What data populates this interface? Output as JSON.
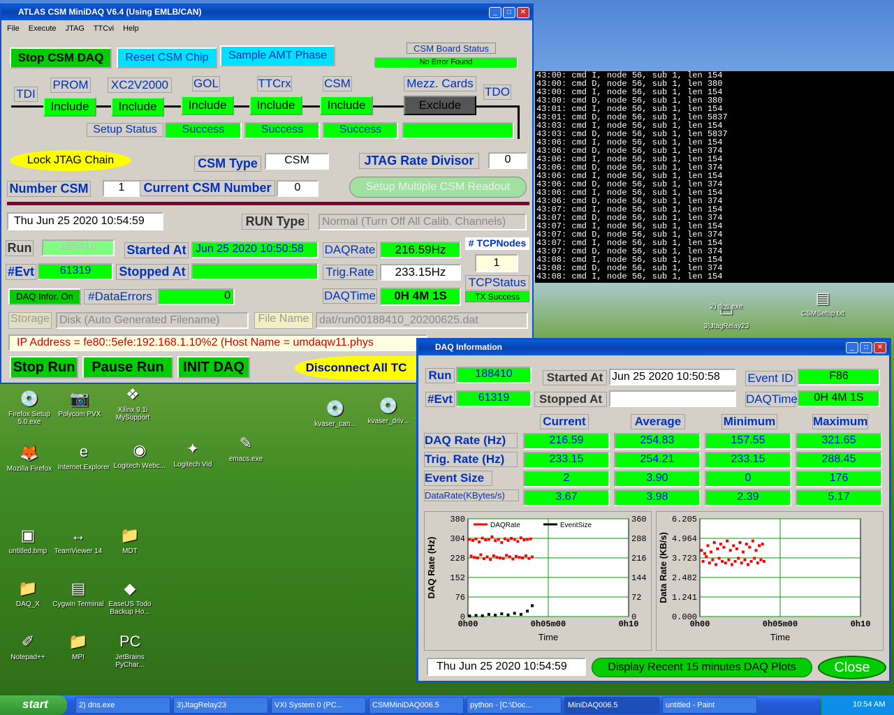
{
  "main": {
    "title": "ATLAS CSM MiniDAQ V6.4 (Using EMLB/CAN)",
    "menu": [
      "File",
      "Execute",
      "JTAG",
      "TTCvi",
      "Help"
    ],
    "stop_csm": "Stop CSM DAQ",
    "reset_csm": "Reset CSM Chip",
    "sample_amt": "Sample AMT Phase",
    "board_status_lbl": "CSM Board Status",
    "board_status": "No Error Found",
    "tdi": "TDI",
    "tdo": "TDO",
    "chain": [
      {
        "name": "PROM",
        "state": "Include"
      },
      {
        "name": "XC2V2000",
        "state": "Include"
      },
      {
        "name": "GOL",
        "state": "Include"
      },
      {
        "name": "TTCrx",
        "state": "Include"
      },
      {
        "name": "CSM",
        "state": "Include"
      },
      {
        "name": "Mezz. Cards",
        "state": "Exclude"
      }
    ],
    "setup_status_lbl": "Setup Status",
    "setup_status": [
      "Success",
      "Success",
      "Success",
      ""
    ],
    "lock_jtag": "Lock JTAG Chain",
    "csm_type_lbl": "CSM Type",
    "csm_type": "CSM",
    "jtag_rate_lbl": "JTAG Rate Divisor",
    "jtag_rate": "0",
    "number_csm_lbl": "Number CSM",
    "number_csm": "1",
    "current_csm_lbl": "Current CSM Number",
    "current_csm": "0",
    "setup_multi": "Setup Multiple CSM Readout",
    "datetime": "Thu Jun 25 2020 10:54:59",
    "run_type_lbl": "RUN Type",
    "run_type": "Normal (Turn Off All Calib. Channels)",
    "run_lbl": "Run",
    "run": "188410",
    "started_lbl": "Started At",
    "started": "Jun 25 2020 10:50:58",
    "daqrate_lbl": "DAQRate",
    "daqrate": "216.59Hz",
    "tcpnodes_lbl": "# TCPNodes",
    "tcpnodes": "1",
    "evt_lbl": "#Evt",
    "evt": "61319",
    "stopped_lbl": "Stopped At",
    "stopped": "",
    "trigrate_lbl": "Trig.Rate",
    "trigrate": "233.15Hz",
    "daqinfo_btn": "DAQ Infor. On",
    "dataerr_lbl": "#DataErrors",
    "dataerr": "0",
    "daqtime_lbl": "DAQTime",
    "daqtime": "0H 4M 1S",
    "tcpstatus_lbl": "TCPStatus",
    "tcpstatus": "TX Success",
    "storage_lbl": "Storage",
    "storage": "Disk (Auto Generated Filename)",
    "filename_lbl": "File Name",
    "filename": "dat/run00188410_20200625.dat",
    "ip": "IP Address = fe80::5efe:192.168.1.10%2  (Host Name = umdaqw11.phys",
    "stop_run": "Stop Run",
    "pause_run": "Pause Run",
    "init_daq": "INIT DAQ",
    "disconnect": "Disconnect All TC"
  },
  "terminal": [
    "43:00: cmd I, node 56, sub 1, len 154",
    "43:00: cmd D, node 56, sub 1, len 380",
    "43:00: cmd I, node 56, sub 1, len 154",
    "43:00: cmd D, node 56, sub 1, len 380",
    "43:01: cmd I, node 56, sub 1, len 154",
    "43:01: cmd D, node 56, sub 1, len 5837",
    "43:03: cmd I, node 56, sub 1, len 154",
    "43:03: cmd D, node 56, sub 1, len 5837",
    "43:06: cmd I, node 56, sub 1, len 154",
    "43:06: cmd D, node 56, sub 1, len 374",
    "43:06: cmd I, node 56, sub 1, len 154",
    "43:06: cmd D, node 56, sub 1, len 374",
    "43:06: cmd I, node 56, sub 1, len 154",
    "43:06: cmd D, node 56, sub 1, len 374",
    "43:06: cmd I, node 56, sub 1, len 154",
    "43:06: cmd D, node 56, sub 1, len 374",
    "43:07: cmd I, node 56, sub 1, len 154",
    "43:07: cmd D, node 56, sub 1, len 374",
    "43:07: cmd I, node 56, sub 1, len 154",
    "43:07: cmd D, node 56, sub 1, len 374",
    "43:07: cmd I, node 56, sub 1, len 154",
    "43:07: cmd D, node 56, sub 1, len 374",
    "43:08: cmd I, node 56, sub 1, len 154",
    "43:08: cmd D, node 56, sub 1, len 374",
    "43:08: cmd I, node 56, sub 1, len 154"
  ],
  "daqinfo": {
    "title": "DAQ Information",
    "run_lbl": "Run",
    "run": "188410",
    "started_lbl": "Started At",
    "started": "Jun 25 2020 10:50:58",
    "eventid_lbl": "Event ID",
    "eventid": "F86",
    "evt_lbl": "#Evt",
    "evt": "61319",
    "stopped_lbl": "Stopped At",
    "stopped": "",
    "daqtime_lbl": "DAQTime",
    "daqtime": "0H 4M 1S",
    "cols": [
      "Current",
      "Average",
      "Minimum",
      "Maximum"
    ],
    "rows": [
      {
        "label": "DAQ Rate (Hz)",
        "vals": [
          "216.59",
          "254.83",
          "157.55",
          "321.65"
        ]
      },
      {
        "label": "Trig. Rate (Hz)",
        "vals": [
          "233.15",
          "254.21",
          "233.15",
          "288.45"
        ]
      },
      {
        "label": "Event Size",
        "vals": [
          "2",
          "3.90",
          "0",
          "176"
        ]
      },
      {
        "label": "DataRate(KBytes/s)",
        "vals": [
          "3.67",
          "3.98",
          "2.39",
          "5.17"
        ]
      }
    ],
    "datetime": "Thu Jun 25 2020 10:54:59",
    "recent_btn": "Display Recent 15 minutes DAQ Plots",
    "close_btn": "Close"
  },
  "chart_data": [
    {
      "type": "scatter",
      "xlabel": "Time",
      "ylabel": "DAQ Rate (Hz)",
      "y2label": "Event Size",
      "x_ticks": [
        "0h00",
        "0h05m00",
        "0h10"
      ],
      "y_ticks": [
        "380",
        "304",
        "228",
        "152",
        "76",
        "0"
      ],
      "y2_ticks": [
        "360",
        "288",
        "216",
        "144",
        "72",
        "0"
      ],
      "ylim": [
        0,
        380
      ],
      "y2lim": [
        0,
        360
      ],
      "series": [
        {
          "name": "DAQRate",
          "color": "#ff0000",
          "x": [
            0.1,
            0.3,
            0.5,
            0.7,
            0.9,
            1.1,
            1.3,
            1.5,
            1.7,
            1.9,
            2.1,
            2.3,
            2.5,
            2.7,
            2.9,
            3.1,
            3.3,
            3.5,
            3.7,
            3.9,
            0.2,
            0.4,
            0.6,
            0.8,
            1.0,
            1.2,
            1.4,
            1.6,
            1.8,
            2.0,
            2.2,
            2.4,
            2.6,
            2.8,
            3.0,
            3.2,
            3.4,
            3.6,
            3.8,
            4.0
          ],
          "y": [
            300,
            296,
            302,
            290,
            305,
            298,
            300,
            310,
            295,
            300,
            288,
            302,
            296,
            304,
            300,
            292,
            306,
            298,
            300,
            302,
            235,
            230,
            228,
            240,
            225,
            232,
            222,
            236,
            230,
            228,
            226,
            238,
            232,
            224,
            234,
            230,
            228,
            236,
            226,
            232
          ]
        },
        {
          "name": "EventSize",
          "color": "#000000",
          "x": [
            0.1,
            0.5,
            0.9,
            1.3,
            1.7,
            2.1,
            2.5,
            2.9,
            3.3,
            3.7,
            4.0
          ],
          "y": [
            2,
            4,
            3,
            8,
            5,
            10,
            6,
            12,
            8,
            20,
            40
          ]
        }
      ]
    },
    {
      "type": "scatter",
      "xlabel": "Time",
      "ylabel": "Data Rate (KB/s)",
      "x_ticks": [
        "0h00",
        "0h05m00",
        "0h10"
      ],
      "y_ticks": [
        "6.205",
        "4.964",
        "3.723",
        "2.482",
        "1.241",
        "0.000"
      ],
      "ylim": [
        0,
        6.205
      ],
      "series": [
        {
          "color": "#ff0000",
          "x": [
            0.1,
            0.3,
            0.5,
            0.7,
            0.9,
            1.1,
            1.3,
            1.5,
            1.7,
            1.9,
            2.1,
            2.3,
            2.5,
            2.7,
            2.9,
            3.1,
            3.3,
            3.5,
            3.7,
            3.9,
            0.2,
            0.4,
            0.6,
            0.8,
            1.0,
            1.2,
            1.4,
            1.6,
            1.8,
            2.0,
            2.2,
            2.4,
            2.6,
            2.8,
            3.0,
            3.2,
            3.4,
            3.6,
            3.8,
            4.0
          ],
          "y": [
            4.2,
            4.0,
            4.5,
            4.1,
            4.7,
            4.3,
            4.6,
            4.4,
            4.8,
            4.2,
            4.5,
            4.3,
            4.7,
            4.1,
            4.6,
            4.4,
            4.8,
            4.2,
            4.5,
            4.6,
            3.5,
            3.8,
            3.4,
            3.6,
            3.3,
            3.7,
            3.5,
            3.4,
            3.6,
            3.3,
            3.5,
            3.7,
            3.4,
            3.6,
            3.3,
            3.5,
            3.7,
            3.4,
            3.6,
            3.5
          ]
        }
      ]
    }
  ],
  "desktop_icons": [
    {
      "label": "Firefox Setup 5.0.exe",
      "glyph": "💿"
    },
    {
      "label": "Polycom PVX",
      "glyph": "📷"
    },
    {
      "label": "Xilinx 9.1i MySupport",
      "glyph": "❖"
    },
    {
      "label": "kvaser_can...",
      "glyph": "💿"
    },
    {
      "label": "kvaser_driv...",
      "glyph": "💿"
    },
    {
      "label": "Mozilla Firefox",
      "glyph": "🦊"
    },
    {
      "label": "Internet Explorer",
      "glyph": "e"
    },
    {
      "label": "Logitech Webc...",
      "glyph": "◉"
    },
    {
      "label": "Logitech Vid",
      "glyph": "✦"
    },
    {
      "label": "emacs.exe",
      "glyph": "✎"
    },
    {
      "label": "untitled.bmp",
      "glyph": "▣"
    },
    {
      "label": "TeamViewer 14",
      "glyph": "↔"
    },
    {
      "label": "MDT",
      "glyph": "📁"
    },
    {
      "label": "DAQ_X",
      "glyph": "📁"
    },
    {
      "label": "Cygwin Terminal",
      "glyph": "▤"
    },
    {
      "label": "EaseUS Todo Backup Ho...",
      "glyph": "◆"
    },
    {
      "label": "Notepad++",
      "glyph": "✐"
    },
    {
      "label": "MPI",
      "glyph": "📁"
    },
    {
      "label": "JetBrains PyChar...",
      "glyph": "PC"
    },
    {
      "label": "3)JtagRelay23",
      "glyph": "▭"
    },
    {
      "label": "CSMSetup.txt",
      "glyph": "▤"
    },
    {
      "label": "2) dns.exe",
      "glyph": ""
    }
  ],
  "taskbar": {
    "start": "start",
    "items": [
      "2) dns.exe",
      "3)JtagRelay23",
      "VXI System 0 (PC...",
      "CSMMiniDAQ006.5",
      "python - [C:\\Doc...",
      "MiniDAQ006.5",
      "untitled - Paint"
    ],
    "clock": "10:54 AM"
  }
}
